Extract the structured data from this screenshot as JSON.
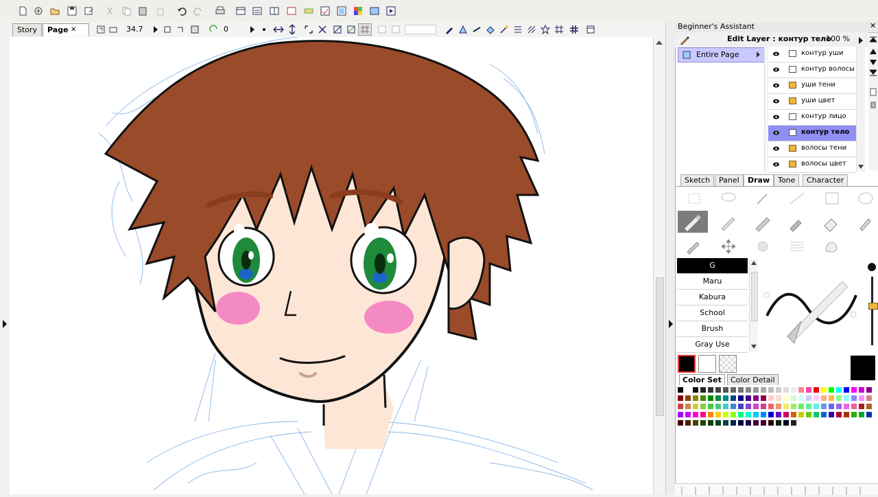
{
  "toolbar": {
    "zoom_value": "34.7",
    "rotate_value": "0"
  },
  "tabs": [
    {
      "label": "Story"
    },
    {
      "label": "Page"
    }
  ],
  "tab_close_glyph": "✕",
  "assistant": {
    "title": "Beginner's Assistant"
  },
  "layers": {
    "edit_label": "Edit Layer : контур тело",
    "opacity": "100 %",
    "page_tree_label": "Entire Page",
    "items": [
      {
        "name": "контур уши",
        "type": "vector"
      },
      {
        "name": "контур волосы",
        "type": "vector"
      },
      {
        "name": "уши тени",
        "type": "raster"
      },
      {
        "name": "уши цвет",
        "type": "raster"
      },
      {
        "name": "контур лицо",
        "type": "vector"
      },
      {
        "name": "контур тело",
        "type": "vector"
      },
      {
        "name": "волосы тени",
        "type": "raster"
      },
      {
        "name": "волосы цвет",
        "type": "raster"
      }
    ],
    "selected_index": 5
  },
  "tool_tabs": [
    {
      "label": "Sketch"
    },
    {
      "label": "Panel"
    },
    {
      "label": "Draw"
    },
    {
      "label": "Tone"
    },
    {
      "label": "Character"
    }
  ],
  "pens": [
    {
      "label": "G"
    },
    {
      "label": "Maru"
    },
    {
      "label": "Kabura"
    },
    {
      "label": "School"
    },
    {
      "label": "Brush"
    },
    {
      "label": "Gray Use"
    }
  ],
  "color_tabs": [
    {
      "label": "Color Set"
    },
    {
      "label": "Color Detail"
    }
  ],
  "colors": {
    "hair": "#9a4b2a",
    "skin": "#fde6d6",
    "eye": "#1f8a3a",
    "blush": "#f48ac4",
    "sketch": "#6fa6e0",
    "layer_selected": "#8f8ff5",
    "current_color": "#000000"
  }
}
